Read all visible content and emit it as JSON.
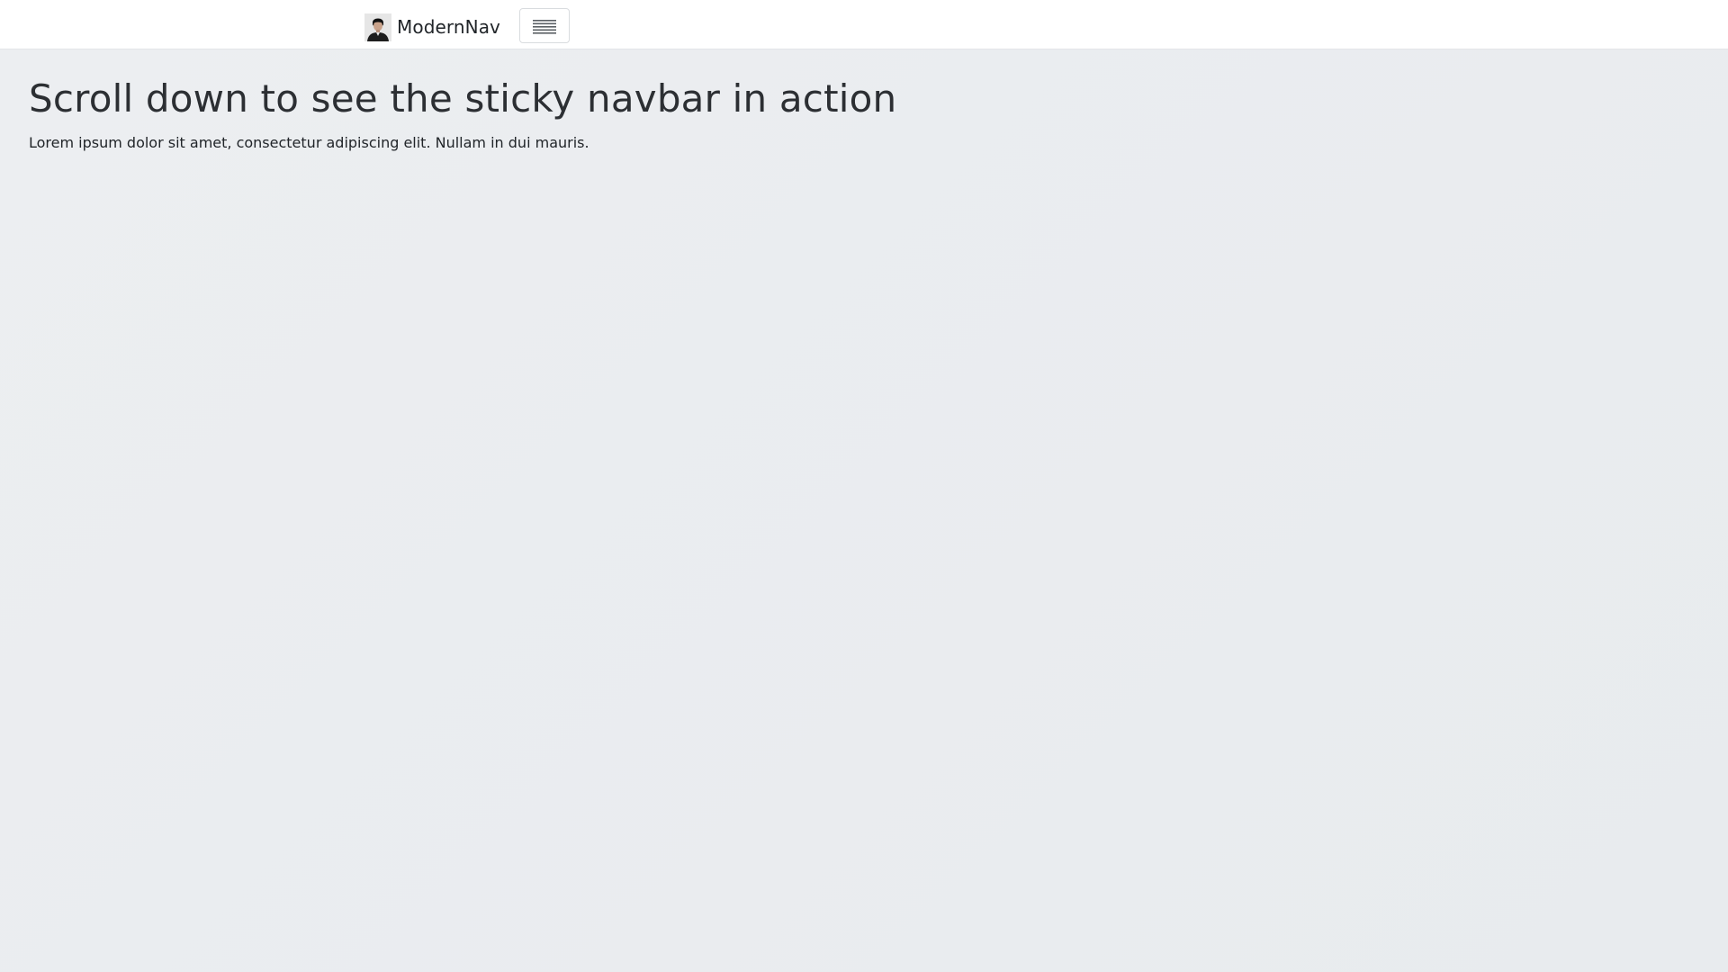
{
  "navbar": {
    "brand": {
      "logo_icon": "avatar-logo-icon",
      "name": "ModernNav"
    },
    "toggler": {
      "icon": "hamburger-menu-icon"
    }
  },
  "main": {
    "heading": "Scroll down to see the sticky navbar in action",
    "lead": "Lorem ipsum dolor sit amet, consectetur adipiscing elit. Nullam in dui mauris."
  },
  "colors": {
    "navbar_background": "#ffffff",
    "page_background": "#eaedf0",
    "text": "#212529",
    "heading_text": "#2c2f33",
    "toggler_border": "#d9dcdf"
  }
}
